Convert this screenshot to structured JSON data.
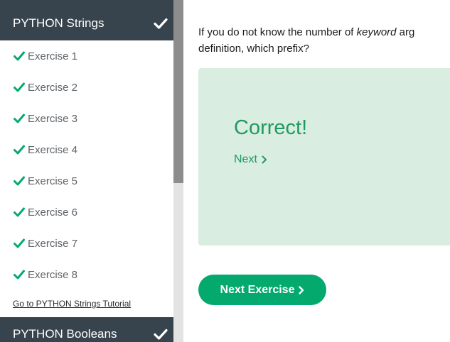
{
  "sidebar": {
    "current_section": {
      "label": "PYTHON Strings",
      "completed_icon": "check-icon"
    },
    "exercises": [
      {
        "label": "Exercise 1",
        "icon": "check-icon"
      },
      {
        "label": "Exercise 2",
        "icon": "check-icon"
      },
      {
        "label": "Exercise 3",
        "icon": "check-icon"
      },
      {
        "label": "Exercise 4",
        "icon": "check-icon"
      },
      {
        "label": "Exercise 5",
        "icon": "check-icon"
      },
      {
        "label": "Exercise 6",
        "icon": "check-icon"
      },
      {
        "label": "Exercise 7",
        "icon": "check-icon"
      },
      {
        "label": "Exercise 8",
        "icon": "check-icon"
      }
    ],
    "tutorial_link": "Go to PYTHON Strings Tutorial",
    "next_section": {
      "label": "PYTHON Booleans",
      "completed_icon": "check-icon"
    }
  },
  "main": {
    "question": {
      "part1": "If you do not know the number of ",
      "keyword": "keyword",
      "part2": " arg",
      "line2": "definition, which prefix?"
    },
    "result": {
      "title": "Correct!",
      "next_label": "Next"
    },
    "next_exercise_label": "Next Exercise"
  },
  "colors": {
    "sidebar_header_bg": "#38444d",
    "accent_green": "#04aa6d",
    "result_bg": "#d9ede1",
    "result_text": "#1f9a60"
  }
}
